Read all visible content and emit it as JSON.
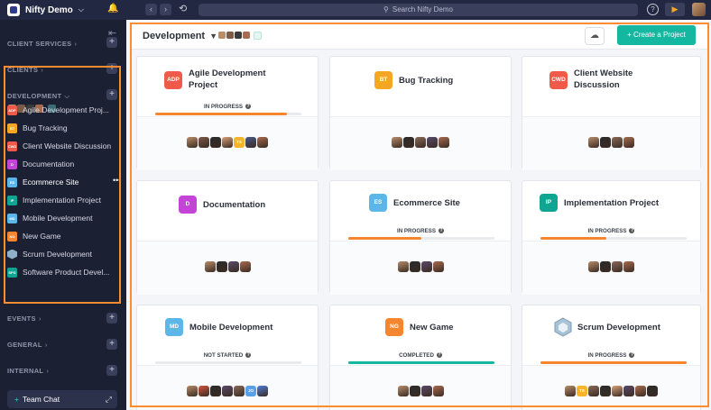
{
  "app": {
    "workspace": "Nifty Demo"
  },
  "topbar": {
    "search_placeholder": "Search Nifty Demo"
  },
  "sidebar": {
    "sections": {
      "client_services": "CLIENT SERVICES",
      "clients": "CLIENTS",
      "development": "DEVELOPMENT",
      "events": "EVENTS",
      "general": "GENERAL",
      "internal": "INTERNAL"
    },
    "items": [
      {
        "badge": "ADP",
        "color": "#ef5a4a",
        "label": "Agile Development Proj..."
      },
      {
        "badge": "BT",
        "color": "#f5a623",
        "label": "Bug Tracking"
      },
      {
        "badge": "CWD",
        "color": "#ef5a4a",
        "label": "Client Website Discussion"
      },
      {
        "badge": "D",
        "color": "#c444d8",
        "label": "Documentation"
      },
      {
        "badge": "ES",
        "color": "#5cb7e8",
        "label": "Ecommerce Site"
      },
      {
        "badge": "IP",
        "color": "#10a593",
        "label": "Implementation Project"
      },
      {
        "badge": "MD",
        "color": "#5cb7e8",
        "label": "Mobile Development"
      },
      {
        "badge": "NG",
        "color": "#f5862f",
        "label": "New Game"
      },
      {
        "badge": "",
        "color": "#8fb0c8",
        "label": "Scrum Development"
      },
      {
        "badge": "SPD",
        "color": "#10a593",
        "label": "Software Product Devel..."
      }
    ],
    "team_chat": "Team Chat"
  },
  "main": {
    "title": "Development",
    "create_label": "+ Create a Project"
  },
  "cards": [
    {
      "badge": "ADP",
      "color": "#ef5a4a",
      "name1": "Agile Development",
      "name2": "Project",
      "status": "IN PROGRESS",
      "progress": 0.9,
      "bar_color": "#f5862f",
      "avatars": [
        "#b88d6b",
        "#7a5a48",
        "#2b2b2b",
        "#d9a27a",
        "TS",
        "#4a5a8a",
        "#a86b4f"
      ]
    },
    {
      "badge": "BT",
      "color": "#f5a623",
      "name1": "Bug Tracking",
      "name2": "",
      "status": "",
      "progress": null,
      "bar_color": "",
      "avatars": [
        "#b88d6b",
        "#2b2b2b",
        "#8a6a5a",
        "#5a4a6a",
        "#a86b4f"
      ]
    },
    {
      "badge": "CWD",
      "color": "#ef5a4a",
      "name1": "Client Website",
      "name2": "Discussion",
      "status": "",
      "progress": null,
      "bar_color": "",
      "avatars": [
        "#b88d6b",
        "#2b2b2b",
        "#8a6a5a",
        "#a86b4f"
      ]
    },
    {
      "badge": "D",
      "color": "#c444d8",
      "name1": "Documentation",
      "name2": "",
      "status": "",
      "progress": null,
      "bar_color": "",
      "avatars": [
        "#b88d6b",
        "#2b2b2b",
        "#5a4a6a",
        "#a86b4f"
      ]
    },
    {
      "badge": "ES",
      "color": "#5cb7e8",
      "name1": "Ecommerce Site",
      "name2": "",
      "status": "IN PROGRESS",
      "progress": 0.5,
      "bar_color": "#f5862f",
      "avatars": [
        "#b88d6b",
        "#2b2b2b",
        "#5a4a6a",
        "#a86b4f"
      ]
    },
    {
      "badge": "IP",
      "color": "#10a593",
      "name1": "Implementation Project",
      "name2": "",
      "status": "IN PROGRESS",
      "progress": 0.45,
      "bar_color": "#f5862f",
      "avatars": [
        "#b88d6b",
        "#2b2b2b",
        "#8a6a5a",
        "#a86b4f"
      ]
    },
    {
      "badge": "MD",
      "color": "#5cb7e8",
      "name1": "Mobile Development",
      "name2": "",
      "status": "NOT STARTED",
      "progress": 0.0,
      "bar_color": "#f5862f",
      "avatars": [
        "#b88d6b",
        "#d2553e",
        "#2b2b2b",
        "#5a4a6a",
        "#8a6a5a",
        "JO",
        "#4f7ed8"
      ]
    },
    {
      "badge": "NG",
      "color": "#f5862f",
      "name1": "New Game",
      "name2": "",
      "status": "COMPLETED",
      "progress": 1.0,
      "bar_color": "#14b8a0",
      "avatars": [
        "#b88d6b",
        "#2b2b2b",
        "#5a4a6a",
        "#a86b4f"
      ]
    },
    {
      "badge": "",
      "color": "#8fb0c8",
      "name1": "Scrum Development",
      "name2": "",
      "status": "IN PROGRESS",
      "progress": 1.0,
      "bar_color": "#f5862f",
      "avatars": [
        "#b88d6b",
        "TS",
        "#8a6a5a",
        "#2b2b2b",
        "#d9a27a",
        "#5a4a6a",
        "#a86b4f",
        "#2b2b2b"
      ]
    }
  ]
}
